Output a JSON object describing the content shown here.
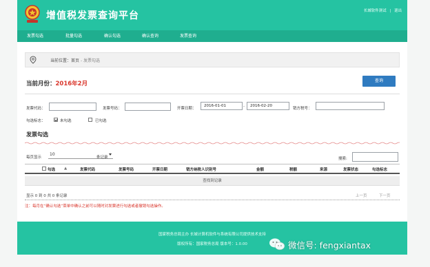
{
  "header": {
    "title": "增值税发票查询平台",
    "user": "长城软件测试",
    "separator": "|",
    "logout": "退出"
  },
  "nav": [
    "发票勾选",
    "批量勾选",
    "确认勾选",
    "确认查询",
    "发票查询"
  ],
  "breadcrumb": {
    "prefix": "当前位置：",
    "home": "首页",
    "current": " - 发票勾选"
  },
  "month": {
    "label": "当前月份：",
    "value": "2016年2月"
  },
  "query_button": "查询",
  "filters": {
    "invoice_code_label": "发票代码：",
    "invoice_number_label": "发票号码：",
    "date_label": "开票日期：",
    "date_from": "2016-01-01",
    "date_sep": "-",
    "date_to": "2016-02-20",
    "seller_id_label": "销方税号：",
    "check_flag_label": "勾选标志：",
    "unchecked_label": "未勾选",
    "checked_label": "已勾选"
  },
  "section_title": "发票勾选",
  "paging": {
    "per_page_label": "每页显示",
    "per_page_value": "10",
    "records_label": "条记录",
    "search_label": "搜索:"
  },
  "table": {
    "headers": [
      "勾选",
      "发票代码",
      "发票号码",
      "开票日期",
      "销方纳税人识别号",
      "金额",
      "税额",
      "来源",
      "发票状态",
      "勾选标志"
    ],
    "empty": "查找到记录"
  },
  "pager": {
    "info": "显示 0 到 0 共 0 条记录",
    "prev": "上一页",
    "next": "下一页"
  },
  "note": "注：每月在“确认勾选”菜单中确认之前可以随时对发票进行勾选或者撤销勾选操作。",
  "footer": {
    "line1": "国家税务总局主办  长城计算机软件与系统有限公司提供技术支持",
    "line2": "版权所有：国家税务总局  版本号：1.0.00"
  },
  "watermark": "微信号: fengxiantax",
  "colors": {
    "header": "#25c3a2",
    "nav": "#1fae8f",
    "query_button": "#2f7bc0",
    "highlight": "#d9352b"
  }
}
